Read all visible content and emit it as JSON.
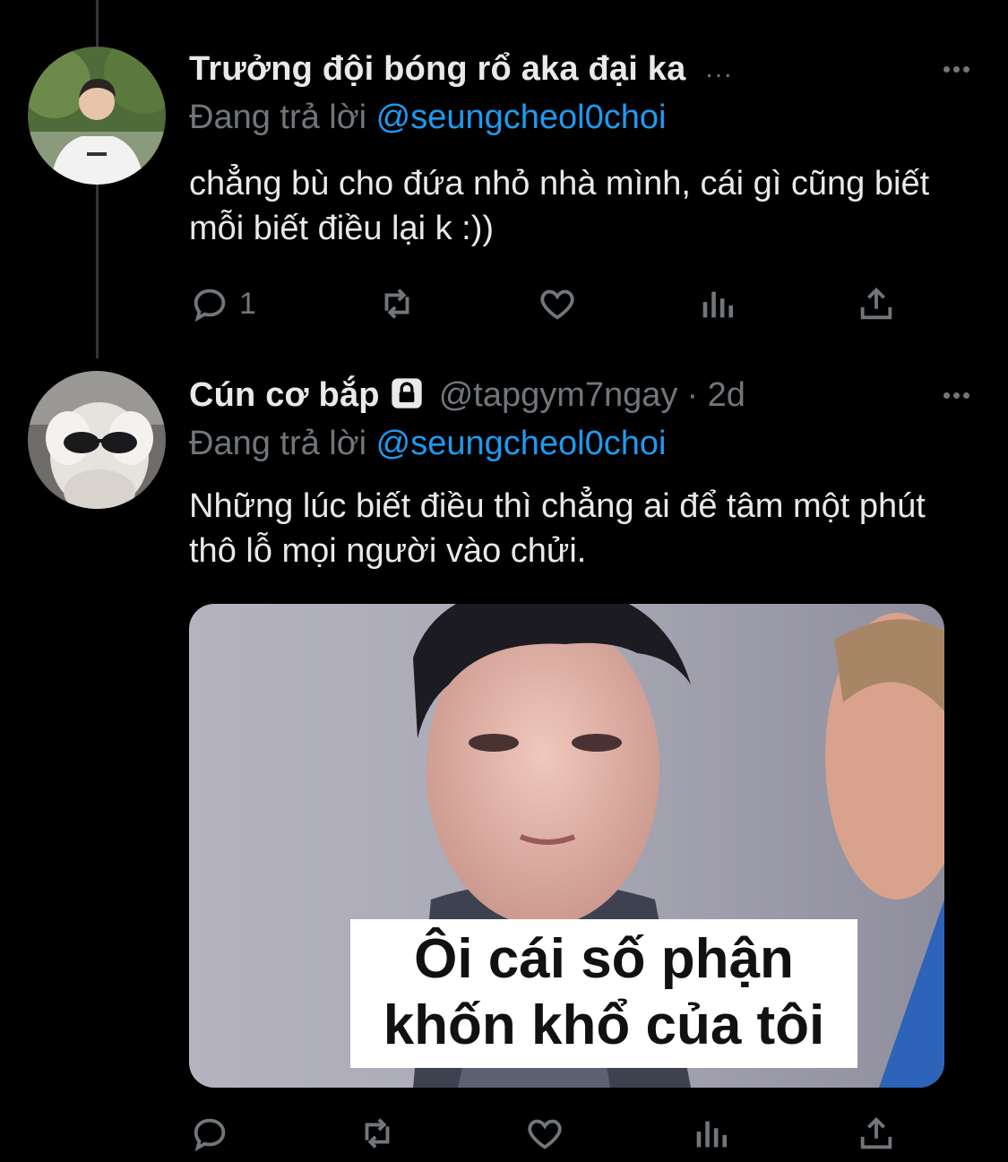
{
  "tweets": [
    {
      "author_name": "Trưởng đội bóng rổ aka đại ka",
      "header_overflow": "...",
      "reply_prefix": "Đang trả lời",
      "reply_to": "@seungcheol0choi",
      "text": "chẳng bù cho đứa nhỏ nhà mình, cái gì cũng biết mỗi biết điều lại k :))",
      "reply_count": "1"
    },
    {
      "author_name": "Cún cơ bắp",
      "locked": true,
      "handle": "@tapgym7ngay",
      "time": "· 2d",
      "reply_prefix": "Đang trả lời",
      "reply_to": "@seungcheol0choi",
      "text": "Những lúc biết điều thì chẳng ai để tâm một phút thô lỗ mọi người vào chửi.",
      "media_caption": "Ôi cái số phận khốn khổ của tôi"
    }
  ],
  "icons": {
    "reply": "reply-icon",
    "retweet": "retweet-icon",
    "like": "heart-icon",
    "views": "views-icon",
    "share": "share-icon",
    "more": "more-icon",
    "lock": "lock-icon"
  },
  "colors": {
    "background": "#000000",
    "text": "#e7e9ea",
    "muted": "#71767b",
    "link": "#1d9bf0"
  }
}
